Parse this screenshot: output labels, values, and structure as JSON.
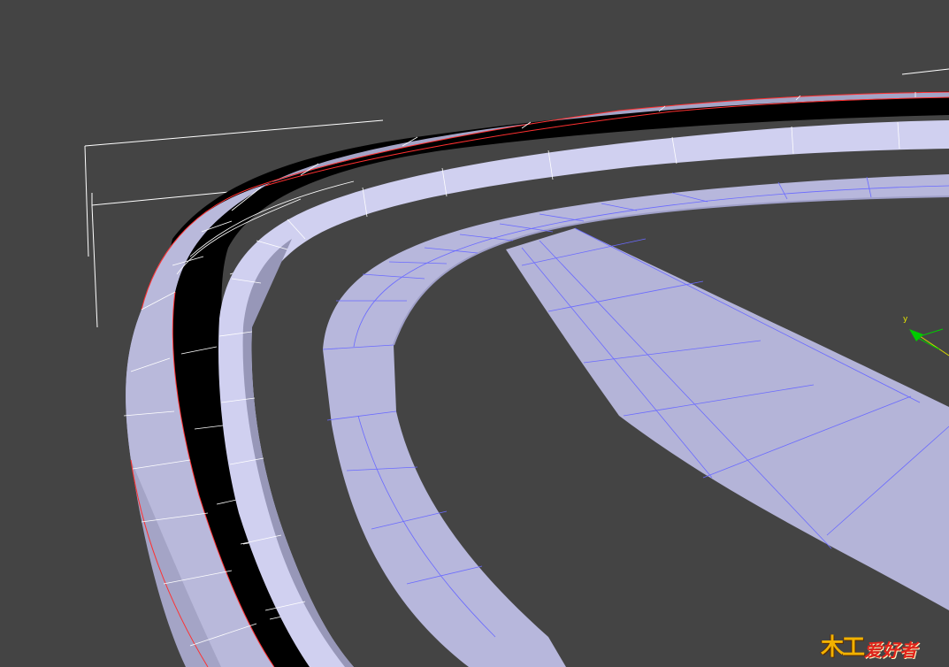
{
  "viewport": {
    "background": "#444444",
    "gizmo": {
      "axis_label": "y"
    }
  },
  "logo": {
    "mark": "木工",
    "text": "爱好者"
  },
  "colors": {
    "surface_light": "#d2d2ee",
    "surface_mid": "#b4b4d8",
    "surface_shade": "#9a9abc",
    "selection_edge": "#ff2020",
    "wire_blue": "#6060ff",
    "wire_white": "#ffffff",
    "gizmo_green": "#00cc00",
    "gizmo_yellow": "#d4d400"
  }
}
